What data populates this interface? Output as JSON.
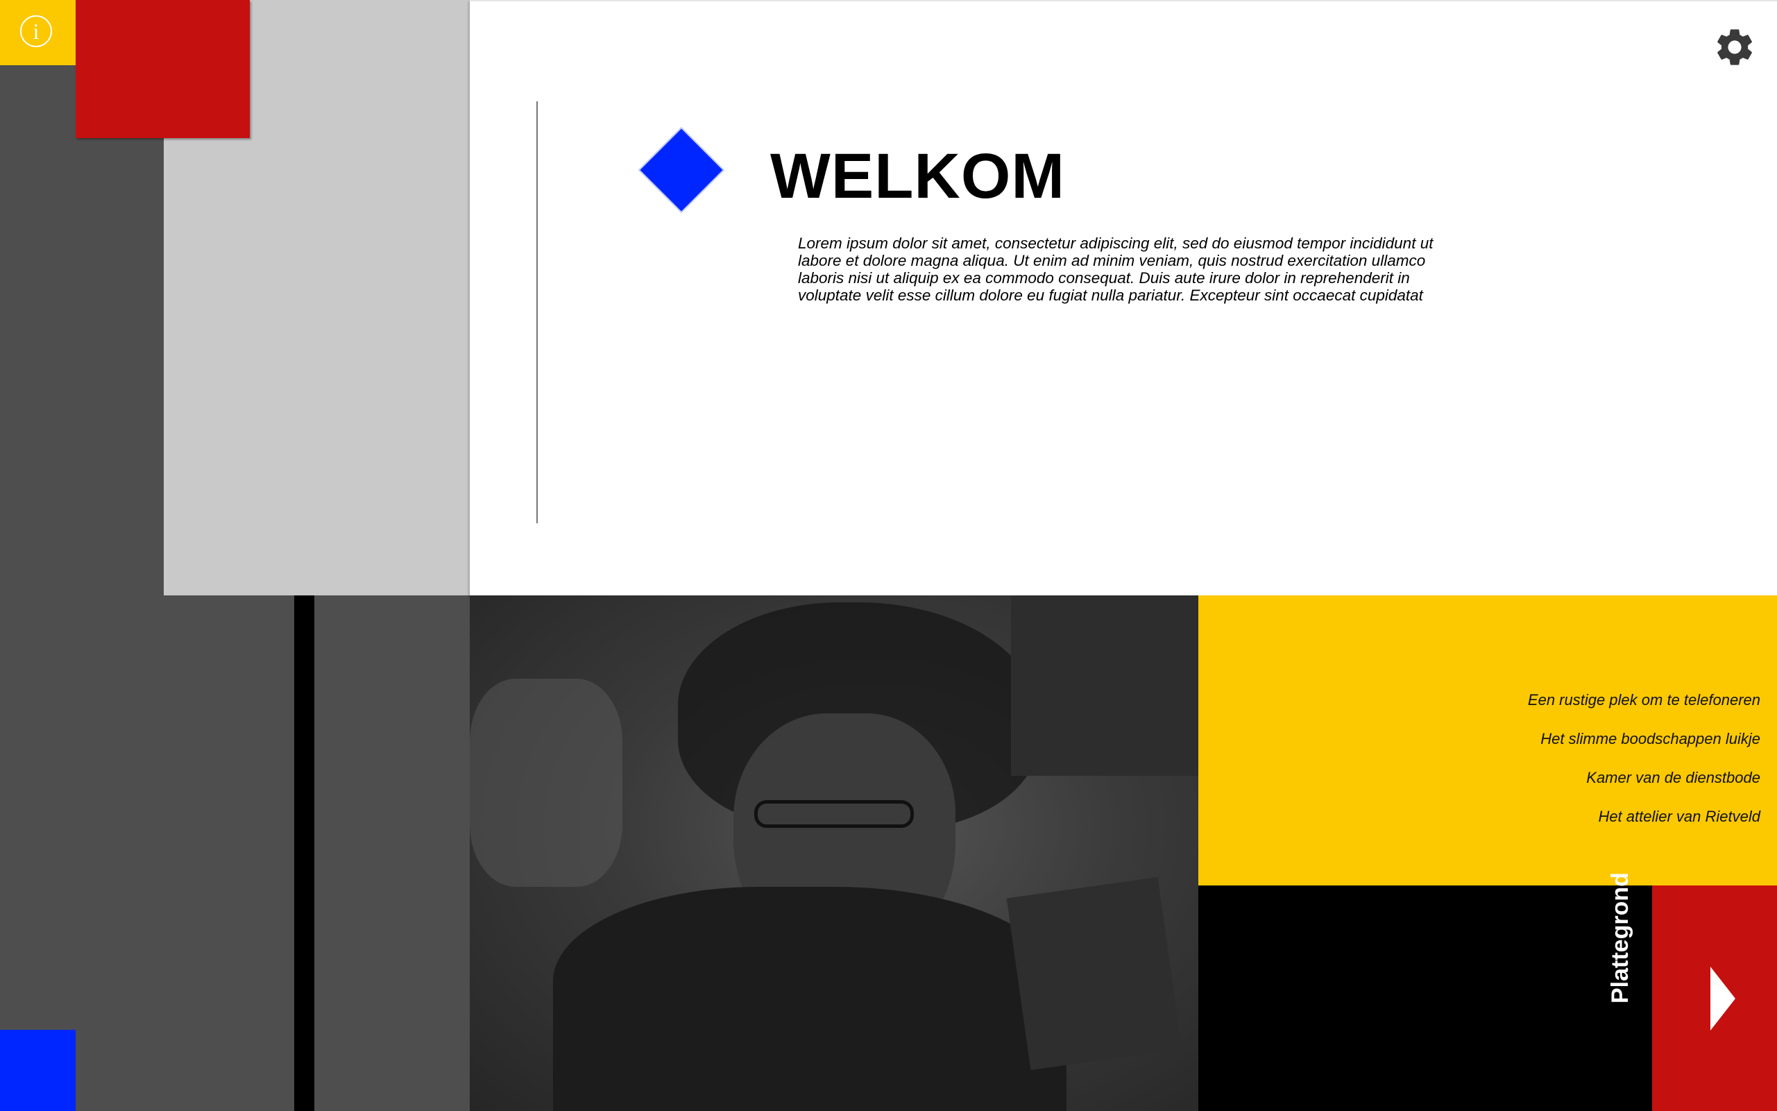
{
  "header": {
    "info_icon": "info-icon",
    "info_glyph": "i",
    "settings_icon": "gear-icon"
  },
  "welcome": {
    "title": "WELKOM",
    "body": "Lorem ipsum dolor sit amet, consectetur adipiscing elit, sed do eiusmod tempor incididunt ut labore et dolore magna aliqua. Ut enim ad minim veniam, quis nostrud exercitation ullamco laboris nisi ut aliquip ex ea commodo consequat. Duis aute irure dolor in reprehenderit in voluptate velit esse cillum dolore eu fugiat nulla pariatur. Excepteur sint occaecat cupidatat"
  },
  "menu": {
    "items": [
      {
        "label": "Een rustige plek om te telefoneren"
      },
      {
        "label": "Het slimme boodschappen luikje"
      },
      {
        "label": "Kamer van de dienstbode"
      },
      {
        "label": "Het attelier van Rietveld"
      }
    ]
  },
  "navigation": {
    "plattegrond_label": "Plattegrond",
    "next_icon": "play-arrow-icon"
  },
  "colors": {
    "yellow": "#fcc800",
    "red": "#c51010",
    "blue": "#0026ff",
    "dark_grey": "#4e4e4e",
    "light_grey": "#c9c9c9"
  }
}
